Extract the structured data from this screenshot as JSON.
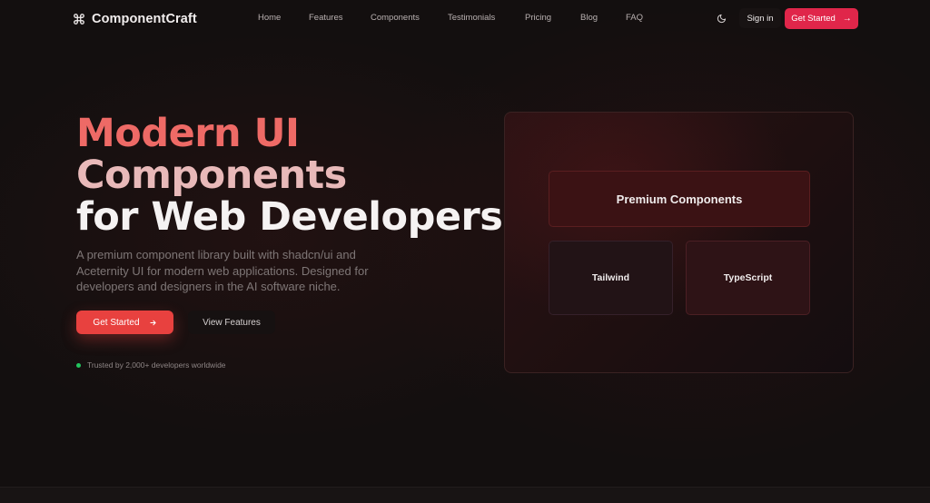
{
  "nav": {
    "brand": "ComponentCraft",
    "brand_icon": "command-icon",
    "links": [
      {
        "label": "Home"
      },
      {
        "label": "Features"
      },
      {
        "label": "Components"
      },
      {
        "label": "Testimonials"
      },
      {
        "label": "Pricing"
      },
      {
        "label": "Blog"
      },
      {
        "label": "FAQ"
      }
    ],
    "theme_icon": "moon-icon",
    "sign_in": "Sign in",
    "cta": "Get Started",
    "cta_icon": "arrow-right-icon"
  },
  "hero": {
    "title_line1": "Modern UI",
    "title_line2": "Components",
    "title_line3": "for Web Developers",
    "description": "A premium component library built with shadcn/ui and Aceternity UI for modern web applications. Designed for developers and designers in the AI software niche.",
    "primary_button": "Get Started",
    "secondary_button": "View Features",
    "trust_text": "Trusted by 2,000+ developers worldwide"
  },
  "showcase": {
    "premium": "Premium Components",
    "tailwind": "Tailwind",
    "typescript": "TypeScript"
  },
  "colors": {
    "accent": "#e0264a",
    "primary_button": "#e8413f",
    "status_dot": "#22c55e",
    "background": "#130f0f"
  }
}
